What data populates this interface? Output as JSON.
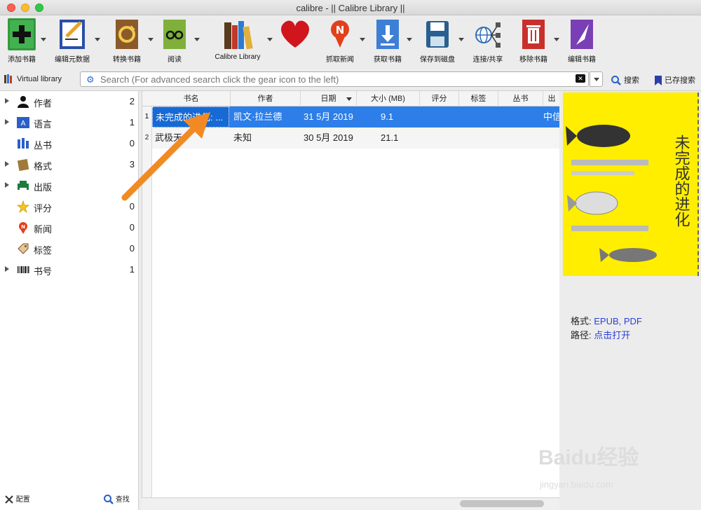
{
  "window": {
    "title": "calibre - || Calibre Library ||"
  },
  "toolbar": {
    "add": "添加书籍",
    "edit": "编辑元数据",
    "convert": "转换书籍",
    "read": "阅读",
    "library": "Calibre Library",
    "news": "抓取新闻",
    "get": "获取书籍",
    "save": "保存到磁盘",
    "connect": "连接/共享",
    "remove": "移除书籍",
    "editbook": "编辑书籍"
  },
  "search": {
    "virtual_library": "Virtual library",
    "placeholder": "Search (For advanced search click the gear icon to the left)",
    "search_btn": "搜索",
    "saved_btn": "已存搜索"
  },
  "sidebar": {
    "items": [
      {
        "label": "作者",
        "count": "2"
      },
      {
        "label": "语言",
        "count": "1"
      },
      {
        "label": "丛书",
        "count": "0"
      },
      {
        "label": "格式",
        "count": "3"
      },
      {
        "label": "出版",
        "count": ""
      },
      {
        "label": "评分",
        "count": "0"
      },
      {
        "label": "新闻",
        "count": "0"
      },
      {
        "label": "标签",
        "count": "0"
      },
      {
        "label": "书号",
        "count": "1"
      }
    ],
    "configure": "配置",
    "find": "查找"
  },
  "table": {
    "headers": [
      "书名",
      "作者",
      "日期",
      "大小 (MB)",
      "评分",
      "标签",
      "丛书",
      "出"
    ],
    "rows": [
      {
        "num": "1",
        "title": "未完成的进化: ...",
        "author": "凯文·拉兰德",
        "date": "31 5月 2019",
        "size": "9.1",
        "publisher": "中信"
      },
      {
        "num": "2",
        "title": "武极天",
        "author": "未知",
        "date": "30 5月 2019",
        "size": "21.1",
        "publisher": ""
      }
    ]
  },
  "details": {
    "formats_label": "格式:",
    "formats_value": "EPUB, PDF",
    "path_label": "路径:",
    "path_value": "点击打开",
    "cover_title": "未完成的进化"
  },
  "watermark": {
    "brand": "Baidu经验",
    "url": "jingyan.baidu.com"
  }
}
